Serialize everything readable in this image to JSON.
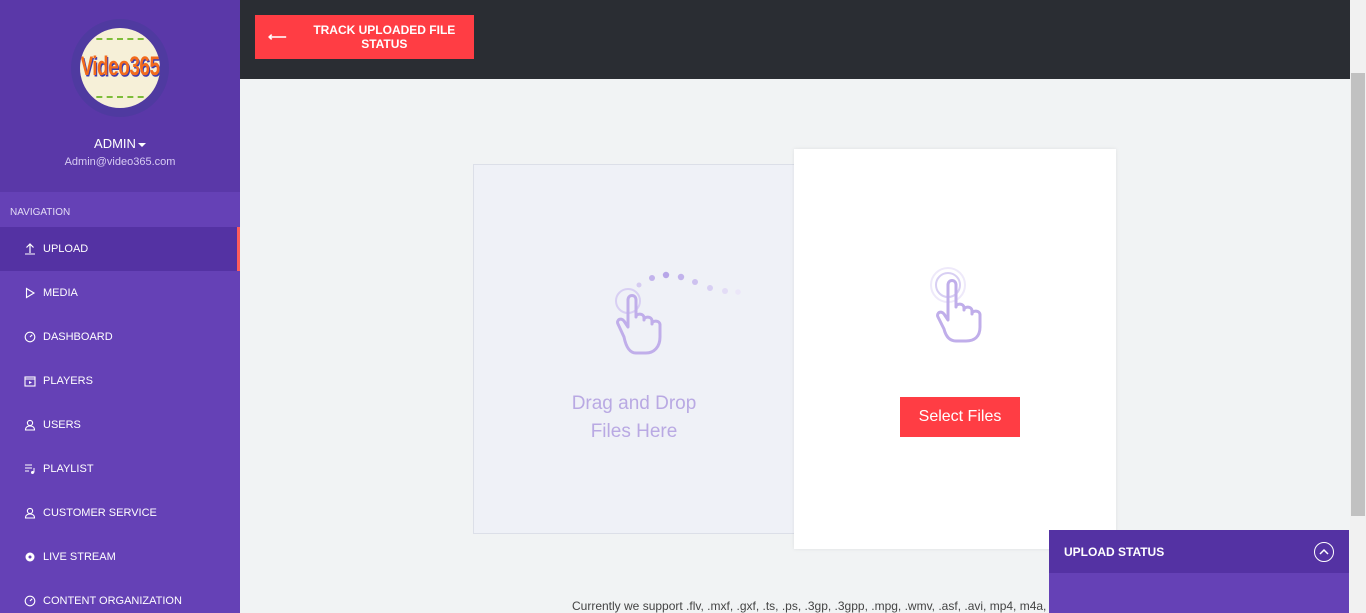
{
  "sidebar": {
    "logo_text": "Video365",
    "user_name": "ADMIN",
    "user_email": "Admin@video365.com",
    "nav_label": "NAVIGATION",
    "items": [
      {
        "label": "UPLOAD",
        "icon": "upload-icon",
        "active": true
      },
      {
        "label": "MEDIA",
        "icon": "play-icon"
      },
      {
        "label": "DASHBOARD",
        "icon": "gauge-icon"
      },
      {
        "label": "PLAYERS",
        "icon": "player-icon"
      },
      {
        "label": "USERS",
        "icon": "user-icon"
      },
      {
        "label": "PLAYLIST",
        "icon": "playlist-icon"
      },
      {
        "label": "CUSTOMER SERVICE",
        "icon": "user-icon"
      },
      {
        "label": "LIVE STREAM",
        "icon": "broadcast-icon"
      },
      {
        "label": "CONTENT ORGANIZATION",
        "icon": "gauge-icon"
      }
    ]
  },
  "topbar": {
    "track_button_label": "TRACK UPLOADED FILE STATUS"
  },
  "upload": {
    "drop_text_line1": "Drag and Drop",
    "drop_text_line2": "Files Here",
    "select_button_label": "Select Files",
    "support_text": "Currently we support .flv, .mxf, .gxf, .ts, .ps, .3gp, .3gpp, .mpg, .wmv, .asf, .avi, mp4, m4a,"
  },
  "upload_status": {
    "title": "UPLOAD STATUS"
  },
  "colors": {
    "sidebar": "#6541b6",
    "accent": "#ff3d44",
    "topbar": "#2a2d33"
  }
}
